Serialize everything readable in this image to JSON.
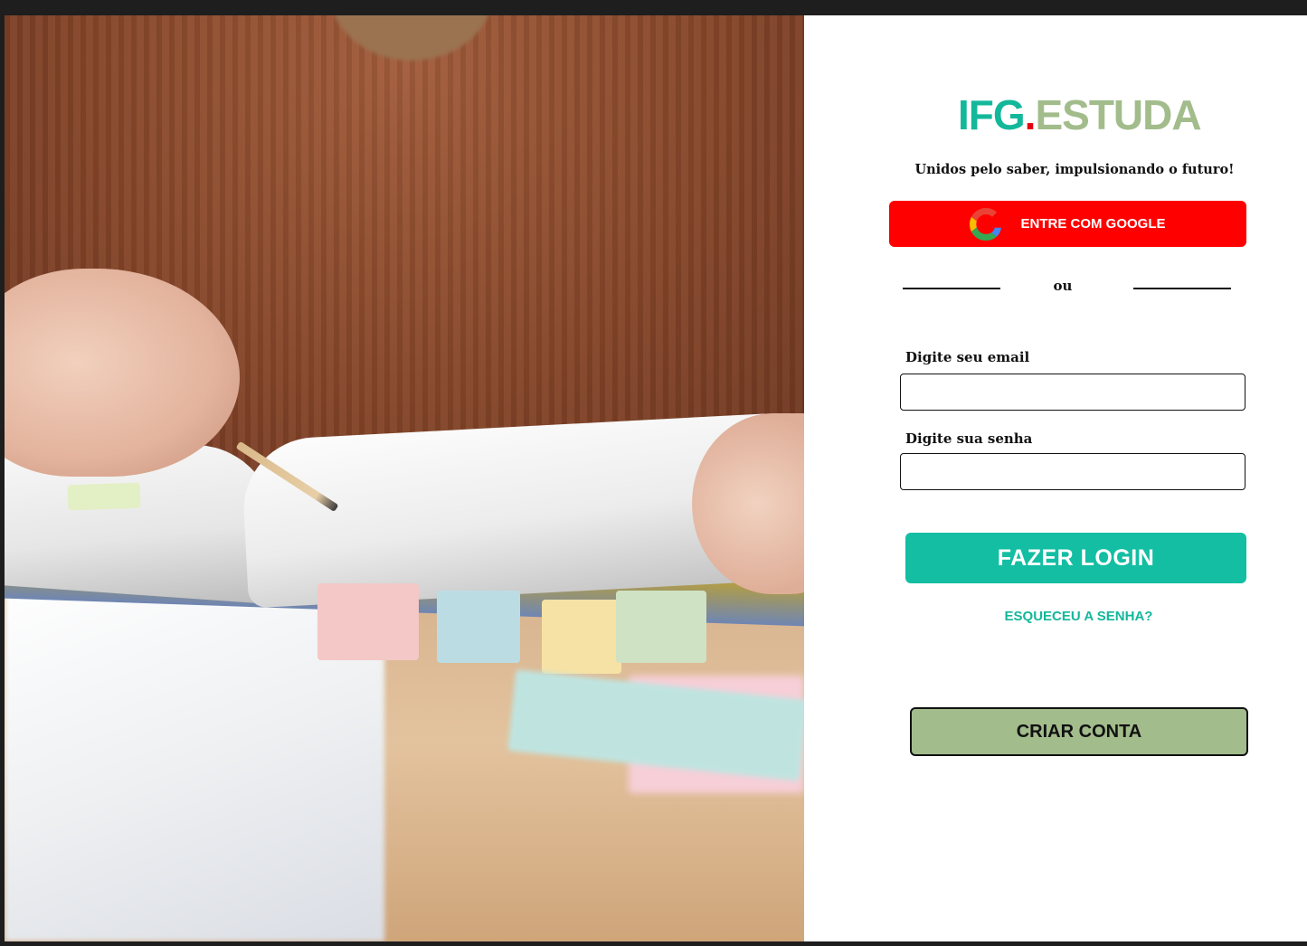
{
  "photo": {
    "alt": "person reading an open book"
  },
  "logo": {
    "part1": "IFG",
    "dot": ".",
    "part2": "ESTUDA"
  },
  "tagline": "Unidos pelo saber, impulsionando o futuro!",
  "google_button": {
    "label": "ENTRE COM GOOGLE",
    "icon": "google-icon"
  },
  "divider": {
    "text": "ou"
  },
  "email_field": {
    "label": "Digite seu email",
    "value": "",
    "placeholder": ""
  },
  "password_field": {
    "label": "Digite sua senha",
    "value": "",
    "placeholder": ""
  },
  "login_button": {
    "label": "FAZER LOGIN"
  },
  "forgot_link": {
    "label": "ESQUECEU A SENHA?"
  },
  "create_button": {
    "label": "CRIAR CONTA"
  },
  "colors": {
    "brand_green": "#13b89b",
    "brand_sage": "#a2bc8b",
    "accent_red": "#e3000f",
    "google_red": "#ff0000",
    "login_teal": "#13bea3"
  }
}
